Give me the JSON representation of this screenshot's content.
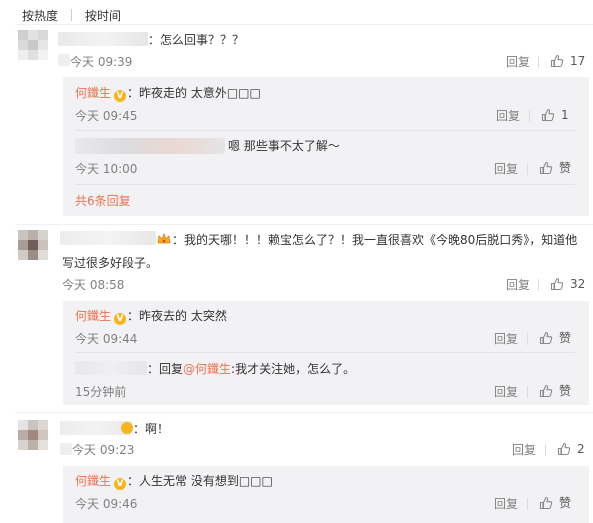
{
  "tabs": [
    "按热度",
    "按时间"
  ],
  "comments": [
    {
      "text": "：怎么回事？？？",
      "time": "今天 09:39",
      "reply_label": "回复",
      "likes": "17",
      "replies": [
        {
          "user": "何鑯生",
          "text": "：昨夜走的 太意外□□□",
          "time": "今天 09:45",
          "reply_label": "回复",
          "likes": "1"
        },
        {
          "text": "嗯 那些事不太了解～",
          "time": "今天 10:00",
          "reply_label": "回复",
          "likes": "赞"
        }
      ],
      "more": "共6条回复"
    },
    {
      "text_line1": "：我的天哪！！！赖宝怎么了？！我一直很喜欢《今晚80后脱口秀》，知道他",
      "text_line2": "写过很多好段子。",
      "time": "今天 08:58",
      "reply_label": "回复",
      "likes": "32",
      "replies": [
        {
          "user": "何鑯生",
          "text": "：昨夜去的 太突然",
          "time": "今天 09:44",
          "reply_label": "回复",
          "likes": "赞"
        },
        {
          "reply_prefix": "：回复",
          "mention": "@何鑯生",
          "text": ":我才关注她，怎么了。",
          "time": "15分钟前",
          "reply_label": "回复",
          "likes": "赞"
        }
      ]
    },
    {
      "text": "：啊！",
      "time": "今天 09:23",
      "reply_label": "回复",
      "likes": "2",
      "replies": [
        {
          "user": "何鑯生",
          "text": "：人生无常 没有想到□□□",
          "time": "今天 09:46",
          "reply_label": "回复",
          "likes": "赞"
        }
      ]
    }
  ],
  "colors": {
    "accent": "#eb7350",
    "reply_bg": "#f2f2f5",
    "vip_badge": "#f6b51d",
    "muted": "#808080"
  },
  "icons": {
    "like": "thumbs-up-icon",
    "vip": "v-badge-icon"
  }
}
